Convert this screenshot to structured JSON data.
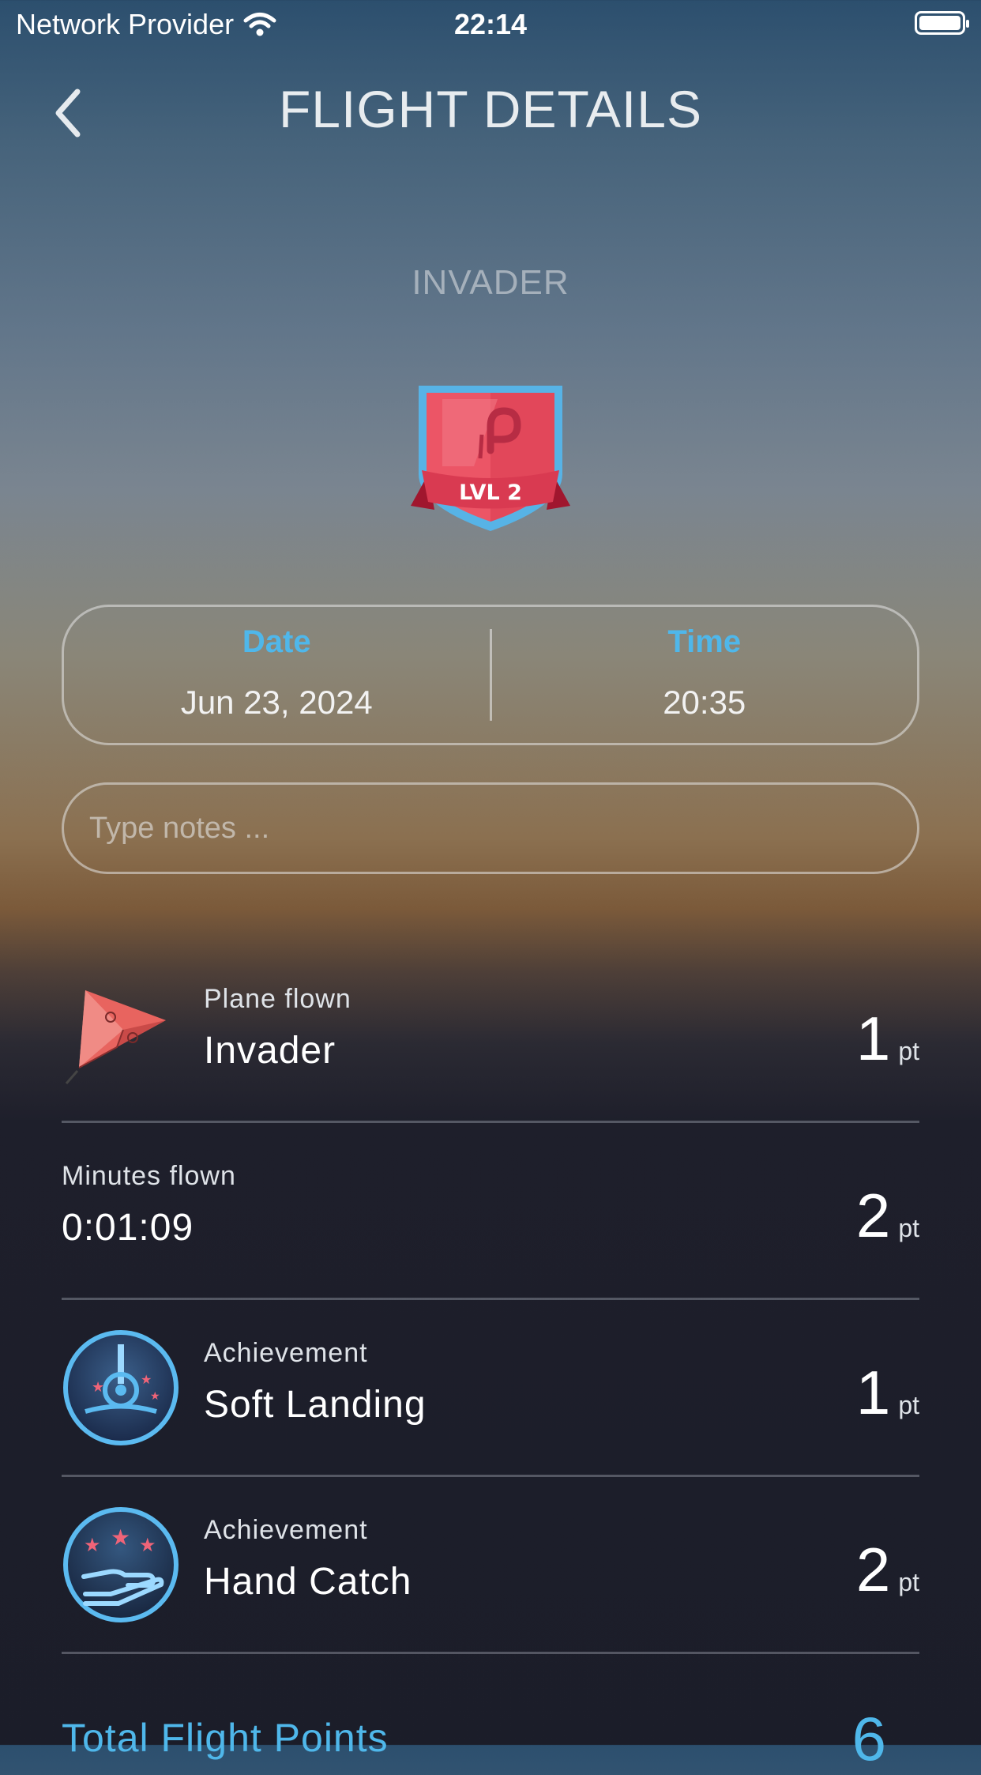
{
  "status_bar": {
    "carrier": "Network Provider",
    "time": "22:14"
  },
  "header": {
    "title": "FLIGHT DETAILS"
  },
  "plane_name": "INVADER",
  "badge": {
    "text": "LVL 2"
  },
  "datetime": {
    "date_label": "Date",
    "date_value": "Jun 23, 2024",
    "time_label": "Time",
    "time_value": "20:35"
  },
  "notes": {
    "placeholder": "Type notes ...",
    "value": ""
  },
  "rows": [
    {
      "label": "Plane flown",
      "value": "Invader",
      "points": "1",
      "unit": "pt",
      "icon": "paper-plane-icon"
    },
    {
      "label": "Minutes flown",
      "value": "0:01:09",
      "points": "2",
      "unit": "pt"
    },
    {
      "label": "Achievement",
      "value": "Soft Landing",
      "points": "1",
      "unit": "pt",
      "icon": "soft-landing-icon"
    },
    {
      "label": "Achievement",
      "value": "Hand Catch",
      "points": "2",
      "unit": "pt",
      "icon": "hand-catch-icon"
    }
  ],
  "total": {
    "label": "Total Flight Points",
    "points": "6"
  },
  "colors": {
    "accent": "#4fb7ea",
    "badge_red": "#e9505f",
    "badge_border": "#57b3e6"
  }
}
